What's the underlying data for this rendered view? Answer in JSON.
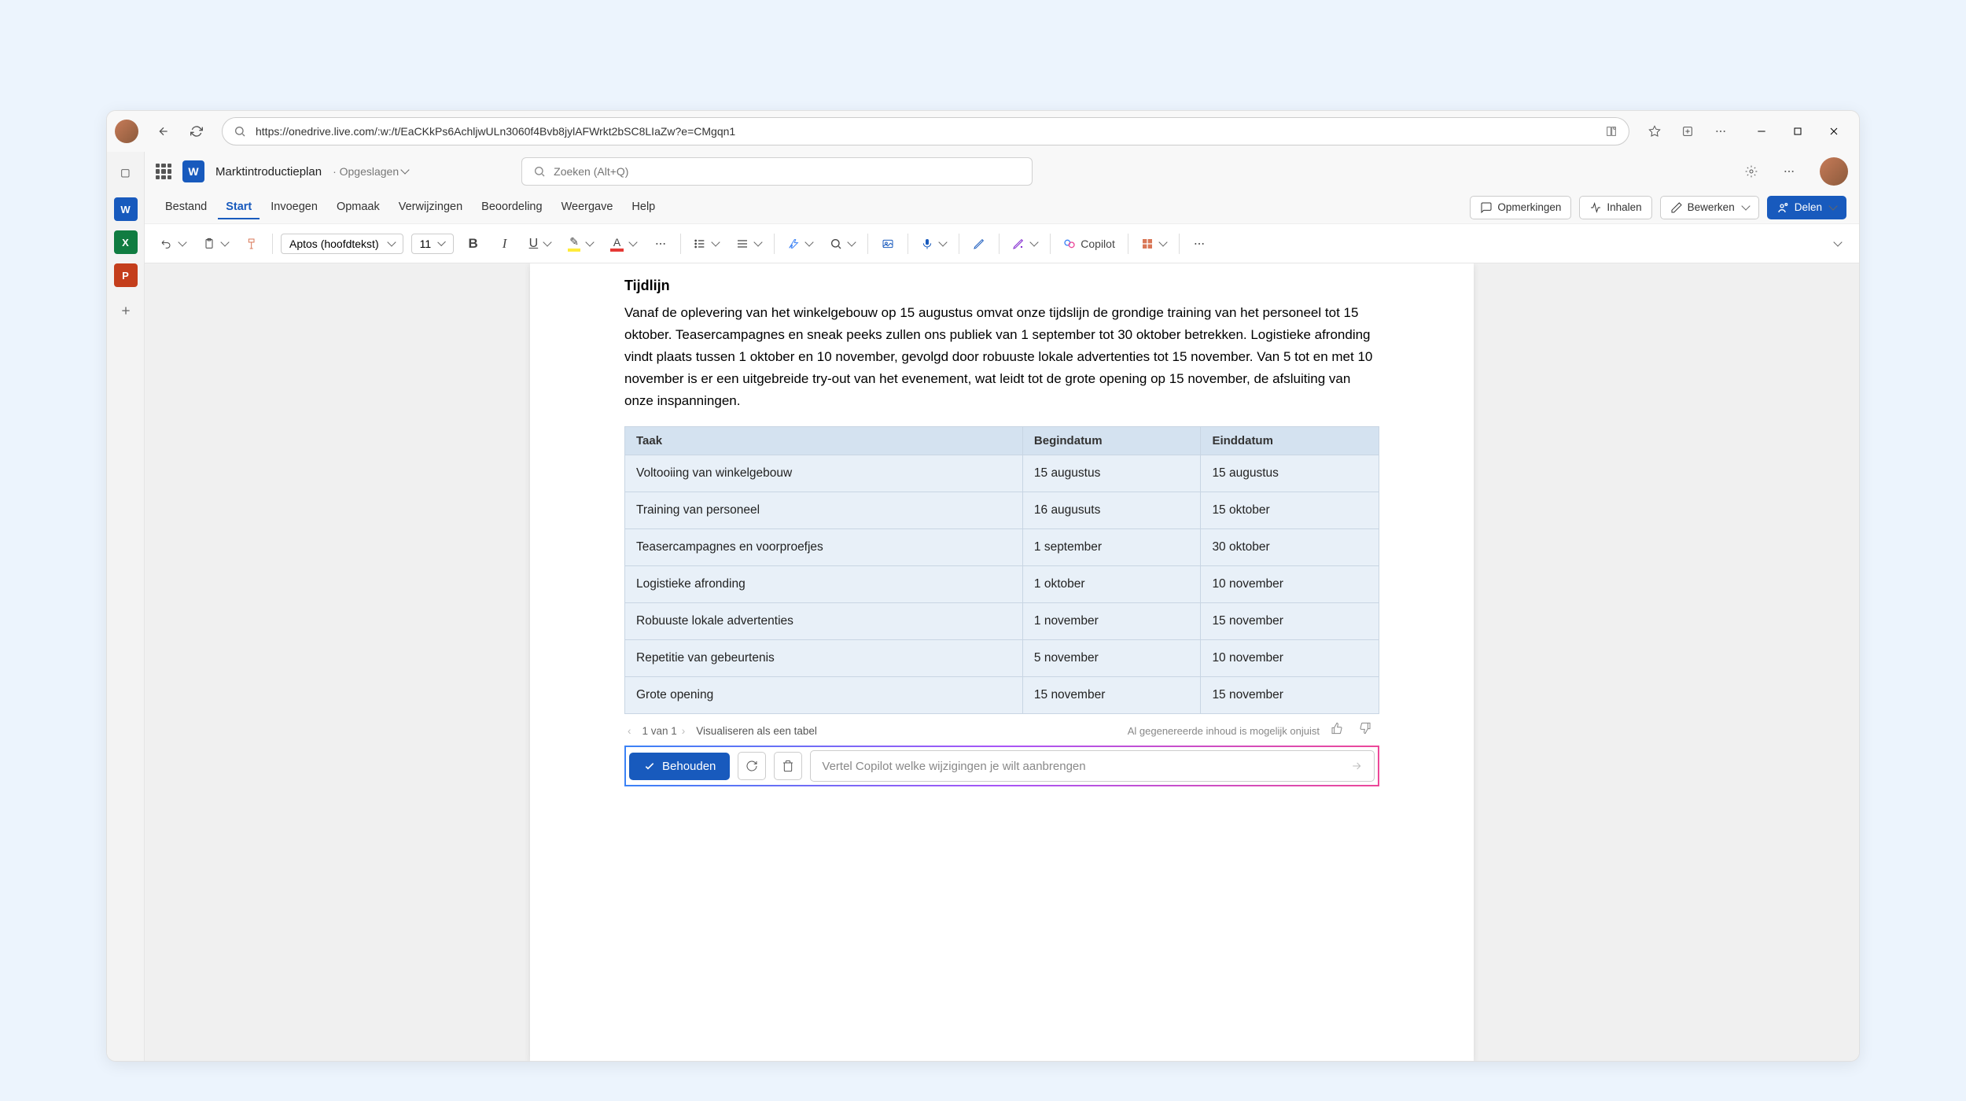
{
  "browser": {
    "url": "https://onedrive.live.com/:w:/t/EaCKkPs6AchljwULn3060f4Bvb8jylAFWrkt2bSC8LIaZw?e=CMgqn1"
  },
  "header": {
    "doc_title": "Marktintroductieplan",
    "doc_status": "· Opgeslagen",
    "search_placeholder": "Zoeken (Alt+Q)"
  },
  "menus": {
    "items": [
      "Bestand",
      "Start",
      "Invoegen",
      "Opmaak",
      "Verwijzingen",
      "Beoordeling",
      "Weergave",
      "Help"
    ],
    "active_index": 1,
    "comments": "Opmerkingen",
    "catchup": "Inhalen",
    "edit": "Bewerken",
    "share": "Delen"
  },
  "ribbon": {
    "font_name": "Aptos (hoofdtekst)",
    "font_size": "11",
    "copilot_label": "Copilot"
  },
  "document": {
    "heading": "Tijdlijn",
    "paragraph": "Vanaf de oplevering van het winkelgebouw op 15 augustus omvat onze tijdslijn de grondige training van het personeel tot 15 oktober. Teasercampagnes en sneak peeks zullen ons publiek van 1 september tot 30 oktober betrekken. Logistieke afronding vindt plaats tussen 1 oktober en 10 november, gevolgd door robuuste lokale advertenties tot 15 november. Van 5 tot en met 10 november is er een uitgebreide try-out van het evenement, wat leidt tot de grote opening op 15 november, de afsluiting van onze inspanningen.",
    "table": {
      "headers": [
        "Taak",
        "Begindatum",
        "Einddatum"
      ],
      "rows": [
        {
          "task": "Voltooiing van winkelgebouw",
          "start": "15 augustus",
          "end": "15 augustus"
        },
        {
          "task": "Training van personeel",
          "start": "16 augusuts",
          "end": "15 oktober"
        },
        {
          "task": "Teasercampagnes en voorproefjes",
          "start": "1 september",
          "end": "30 oktober"
        },
        {
          "task": "Logistieke afronding",
          "start": "1 oktober",
          "end": "10 november"
        },
        {
          "task": "Robuuste lokale advertenties",
          "start": "1 november",
          "end": "15 november"
        },
        {
          "task": "Repetitie van gebeurtenis",
          "start": "5 november",
          "end": "10 november"
        },
        {
          "task": "Grote opening",
          "start": "15 november",
          "end": "15 november"
        }
      ]
    }
  },
  "copilot": {
    "pager": "1 van 1",
    "visualize": "Visualiseren als een tabel",
    "disclaimer": "Al gegenereerde inhoud is mogelijk onjuist",
    "keep_label": "Behouden",
    "input_placeholder": "Vertel Copilot welke wijzigingen je wilt aanbrengen"
  }
}
